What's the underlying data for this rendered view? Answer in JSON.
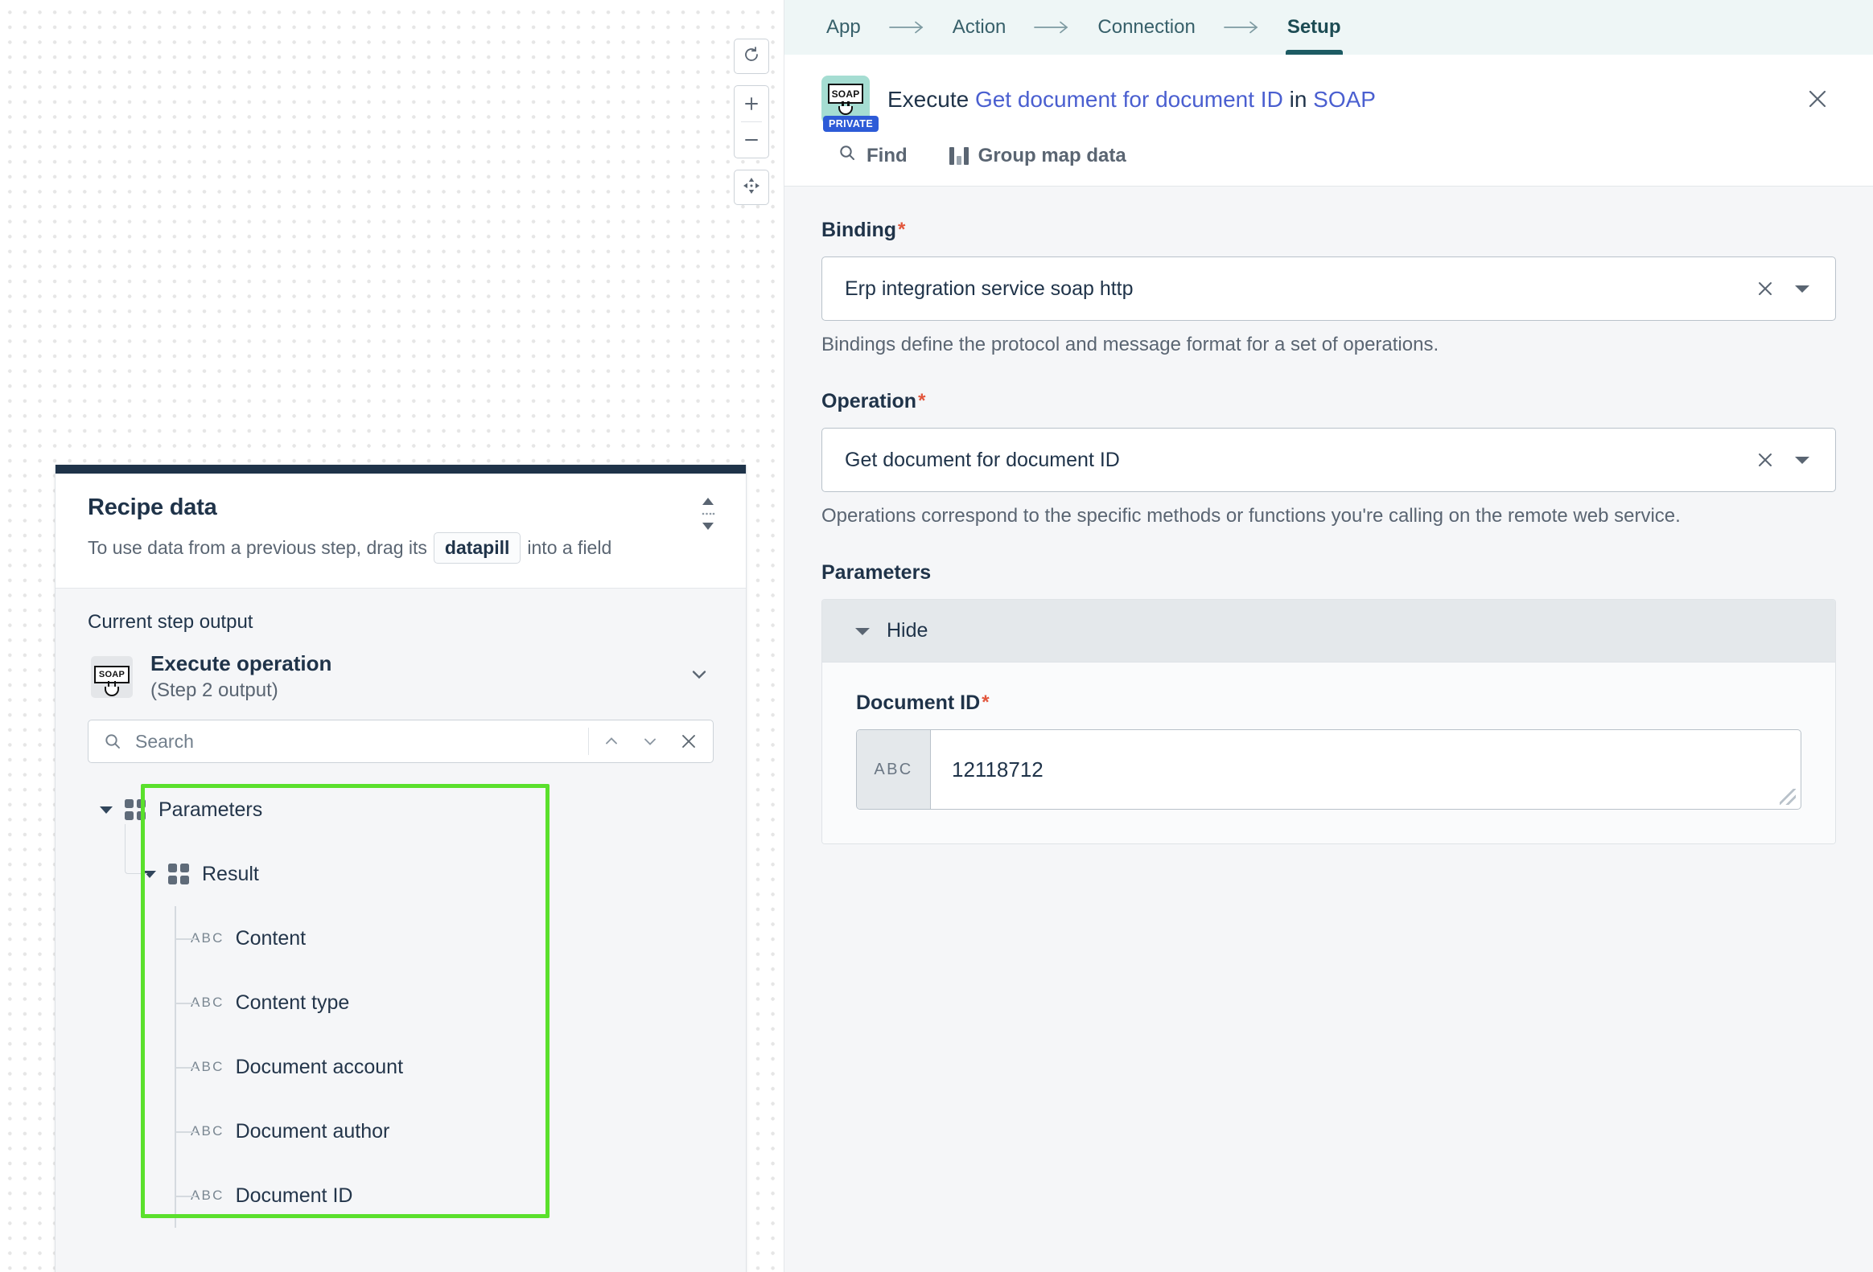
{
  "breadcrumb": {
    "items": [
      {
        "label": "App",
        "active": false
      },
      {
        "label": "Action",
        "active": false
      },
      {
        "label": "Connection",
        "active": false
      },
      {
        "label": "Setup",
        "active": true
      }
    ],
    "arrow": "⟶"
  },
  "panel": {
    "icon_label": "SOAP",
    "icon_badge": "PRIVATE",
    "title_prefix": "Execute",
    "title_link": "Get document for document ID",
    "title_mid": "in",
    "title_app": "SOAP",
    "close_label": "✕",
    "tools": {
      "find_label": "Find",
      "group_map_label": "Group map data"
    }
  },
  "form": {
    "binding": {
      "label": "Binding",
      "required_mark": "*",
      "value": "Erp integration service soap http",
      "helper": "Bindings define the protocol and message format for a set of operations."
    },
    "operation": {
      "label": "Operation",
      "required_mark": "*",
      "value": "Get document for document ID",
      "helper": "Operations correspond to the specific methods or functions you're calling on the remote web service."
    },
    "parameters": {
      "section_label": "Parameters",
      "toggle_label": "Hide",
      "document_id": {
        "label": "Document ID",
        "required_mark": "*",
        "type_badge": "ABC",
        "value": "12118712"
      }
    }
  },
  "recipe": {
    "title": "Recipe data",
    "subtitle_before": "To use data from a previous step, drag its",
    "datapill_chip": "datapill",
    "subtitle_after": "into a field",
    "section_label": "Current step output",
    "step": {
      "name": "Execute operation",
      "meta": "(Step 2 output)",
      "icon_label": "SOAP"
    },
    "search": {
      "placeholder": "Search",
      "value": ""
    },
    "tree": {
      "root": {
        "label": "Parameters",
        "type": "object"
      },
      "child": {
        "label": "Result",
        "type": "object"
      },
      "leaves": [
        {
          "label": "Content",
          "type": "ABC"
        },
        {
          "label": "Content type",
          "type": "ABC"
        },
        {
          "label": "Document account",
          "type": "ABC"
        },
        {
          "label": "Document author",
          "type": "ABC"
        },
        {
          "label": "Document ID",
          "type": "ABC"
        }
      ]
    }
  },
  "canvas": {
    "tools": {
      "reset_label": "reset-view",
      "zoom_in_label": "+",
      "zoom_out_label": "−",
      "fit_label": "fit-view"
    }
  },
  "colors": {
    "accent_teal": "#1c5b63",
    "link_blue": "#4a5fd0",
    "required_red": "#e2563c",
    "highlight_green": "#5ae02c",
    "panel_bg": "#f5f6f8",
    "header_bg": "#eef6f6"
  }
}
